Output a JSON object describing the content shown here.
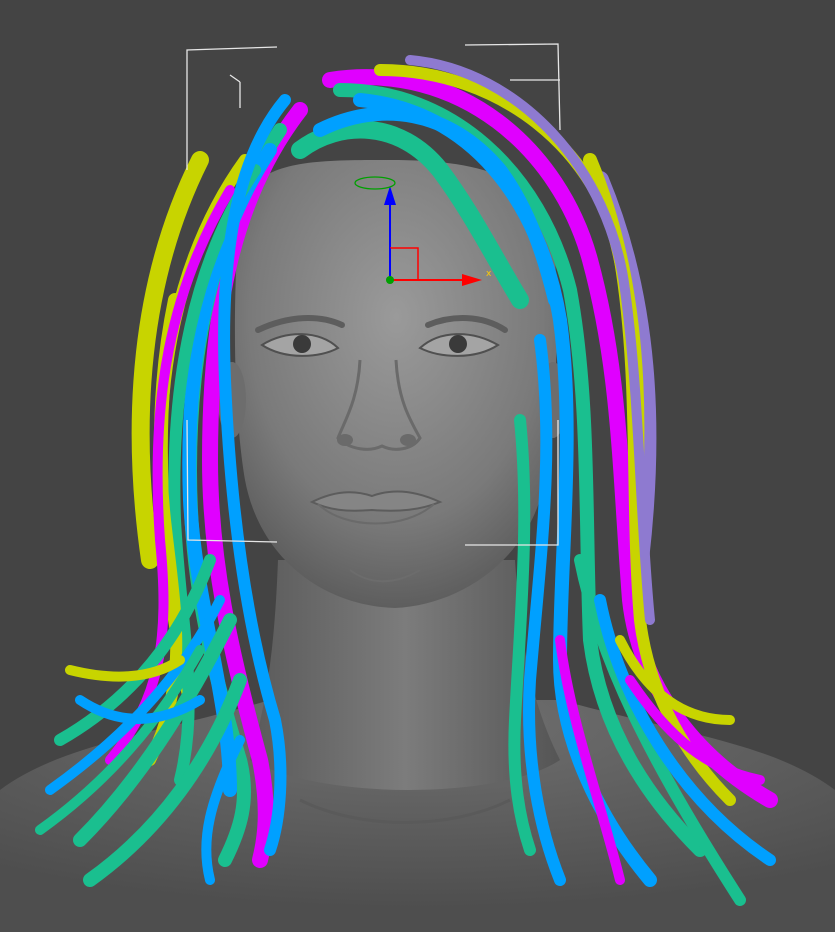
{
  "viewport": {
    "background": "#444444",
    "view": "front",
    "shading": "realistic"
  },
  "model": {
    "skin_color": "#8a8a8a",
    "hair_colors": [
      "#c8d400",
      "#e000ff",
      "#00a0ff",
      "#1abf8f",
      "#8e7ad0"
    ]
  },
  "gizmo": {
    "x_axis_color": "#ff0000",
    "y_axis_color": "#00a000",
    "z_axis_color": "#0000ff",
    "x_label": "x"
  },
  "selection_box": {
    "color": "#e6e6e6"
  }
}
